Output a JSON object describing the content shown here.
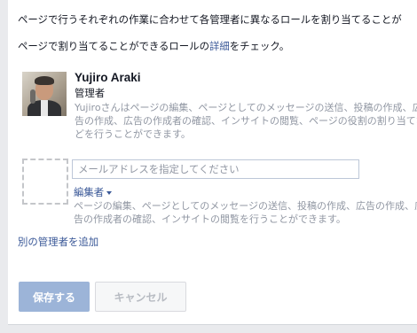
{
  "intro": {
    "line1": "ページで行うそれぞれの作業に合わせて各管理者に異なるロールを割り当てることが",
    "line2_prefix": "ページで割り当てることができるロールの",
    "line2_link": "詳細",
    "line2_suffix": "をチェック。"
  },
  "current_admin": {
    "name": "Yujiro Araki",
    "role": "管理者",
    "description": "Yujiroさんはページの編集、ページとしてのメッセージの送信、投稿の作成、広告の作成、広告の作成者の確認、インサイトの閲覧、ページの役割の割り当てなどを行うことができます。"
  },
  "new_admin": {
    "email_placeholder": "メールアドレスを指定してください",
    "role_label": "編集者",
    "role_description": "ページの編集、ページとしてのメッセージの送信、投稿の作成、広告の作成、広告の作成者の確認、インサイトの閲覧を行うことができます。"
  },
  "add_admin_link": "別の管理者を追加",
  "buttons": {
    "save": "保存する",
    "cancel": "キャンセル"
  }
}
